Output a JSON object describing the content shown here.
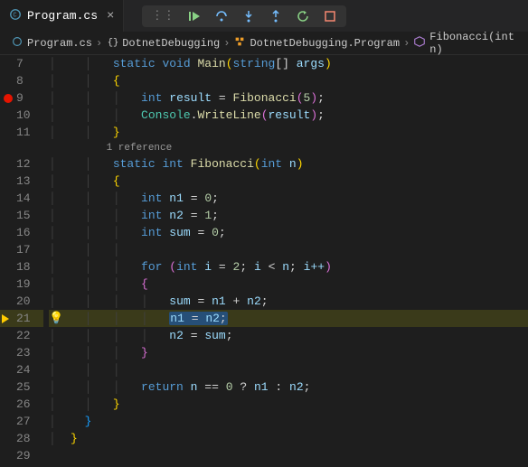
{
  "tab": {
    "filename": "Program.cs"
  },
  "breadcrumbs": {
    "file": "Program.cs",
    "ns": "DotnetDebugging",
    "class": "DotnetDebugging.Program",
    "method": "Fibonacci(int n)"
  },
  "codelens": {
    "references": "1 reference"
  },
  "lines": {
    "l7": "7",
    "l8": "8",
    "l9": "9",
    "l10": "10",
    "l11": "11",
    "l12": "12",
    "l13": "13",
    "l14": "14",
    "l15": "15",
    "l16": "16",
    "l17": "17",
    "l18": "18",
    "l19": "19",
    "l20": "20",
    "l21": "21",
    "l22": "22",
    "l23": "23",
    "l24": "24",
    "l25": "25",
    "l26": "26",
    "l27": "27",
    "l28": "28",
    "l29": "29"
  },
  "code": {
    "l7": {
      "kw1": "static",
      "kw2": "void",
      "fn": "Main",
      "type": "string",
      "arr": "[]",
      "arg": "args"
    },
    "l9": {
      "type": "int",
      "var": "result",
      "fn": "Fibonacci",
      "num": "5"
    },
    "l10": {
      "cls": "Console",
      "fn": "WriteLine",
      "arg": "result"
    },
    "l12": {
      "kw1": "static",
      "type": "int",
      "fn": "Fibonacci",
      "argtype": "int",
      "arg": "n"
    },
    "l14": {
      "type": "int",
      "var": "n1",
      "num": "0"
    },
    "l15": {
      "type": "int",
      "var": "n2",
      "num": "1"
    },
    "l16": {
      "type": "int",
      "var": "sum",
      "num": "0"
    },
    "l18": {
      "kw": "for",
      "type": "int",
      "var": "i",
      "num1": "2",
      "cond": "i",
      "lt": "<",
      "n": "n",
      "inc": "i++"
    },
    "l20": {
      "lhs": "sum",
      "r1": "n1",
      "r2": "n2"
    },
    "l21": {
      "lhs": "n1",
      "rhs": "n2"
    },
    "l22": {
      "lhs": "n2",
      "rhs": "sum"
    },
    "l25": {
      "kw": "return",
      "n": "n",
      "eq": "==",
      "z": "0",
      "q": "?",
      "n1": "n1",
      "c": ":",
      "n2": "n2"
    }
  },
  "debug": {
    "breakpoint_line": 9,
    "current_line": 21
  }
}
